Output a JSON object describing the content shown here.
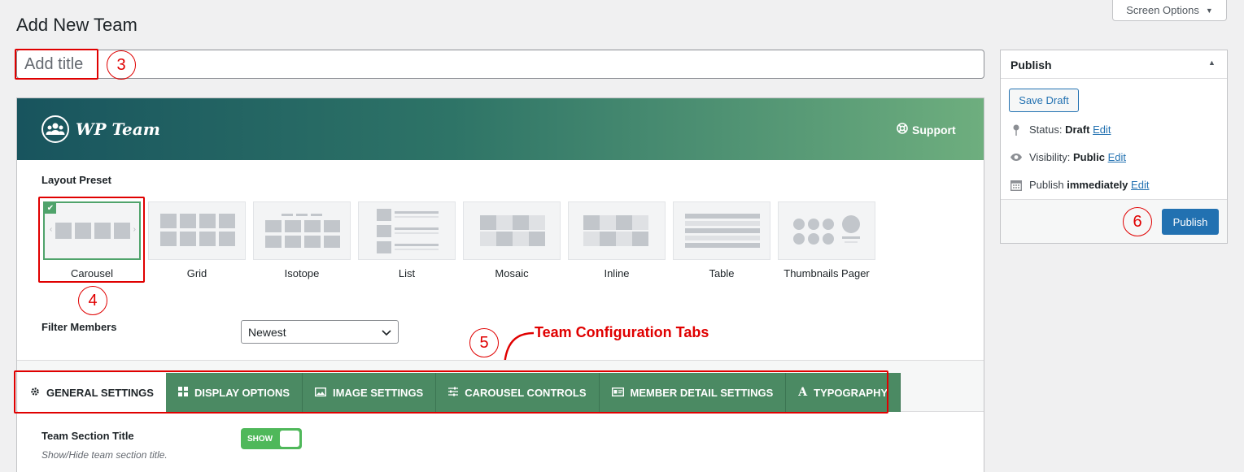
{
  "page": {
    "title": "Add New Team"
  },
  "screen_options": {
    "label": "Screen Options"
  },
  "title_field": {
    "placeholder": "Add title"
  },
  "banner": {
    "logo_text": "WP Team",
    "support_label": "Support"
  },
  "layout_preset": {
    "label": "Layout Preset",
    "options": [
      {
        "label": "Carousel",
        "selected": true
      },
      {
        "label": "Grid"
      },
      {
        "label": "Isotope"
      },
      {
        "label": "List"
      },
      {
        "label": "Mosaic"
      },
      {
        "label": "Inline"
      },
      {
        "label": "Table"
      },
      {
        "label": "Thumbnails Pager"
      }
    ]
  },
  "filter_members": {
    "label": "Filter Members",
    "selected": "Newest"
  },
  "annotation": {
    "tabs_caption": "Team Configuration Tabs",
    "markers": [
      "3",
      "4",
      "5",
      "6"
    ]
  },
  "tabs": [
    {
      "label": "GENERAL SETTINGS",
      "icon": "gear-icon",
      "active": true
    },
    {
      "label": "DISPLAY OPTIONS",
      "icon": "grid-icon"
    },
    {
      "label": "IMAGE SETTINGS",
      "icon": "image-icon"
    },
    {
      "label": "CAROUSEL CONTROLS",
      "icon": "sliders-icon"
    },
    {
      "label": "MEMBER DETAIL SETTINGS",
      "icon": "id-card-icon"
    },
    {
      "label": "TYPOGRAPHY",
      "icon": "font-icon"
    }
  ],
  "general": {
    "section_title": {
      "label": "Team Section Title",
      "description": "Show/Hide team section title.",
      "toggle_label": "SHOW"
    }
  },
  "publish": {
    "title": "Publish",
    "save_draft": "Save Draft",
    "status_label": "Status:",
    "status_value": "Draft",
    "visibility_label": "Visibility:",
    "visibility_value": "Public",
    "schedule_label": "Publish",
    "schedule_value": "immediately",
    "edit_link": "Edit",
    "publish_button": "Publish"
  },
  "colors": {
    "accent": "#2271b1",
    "tab_green": "#4b8a63",
    "annotation_red": "#e00000"
  }
}
